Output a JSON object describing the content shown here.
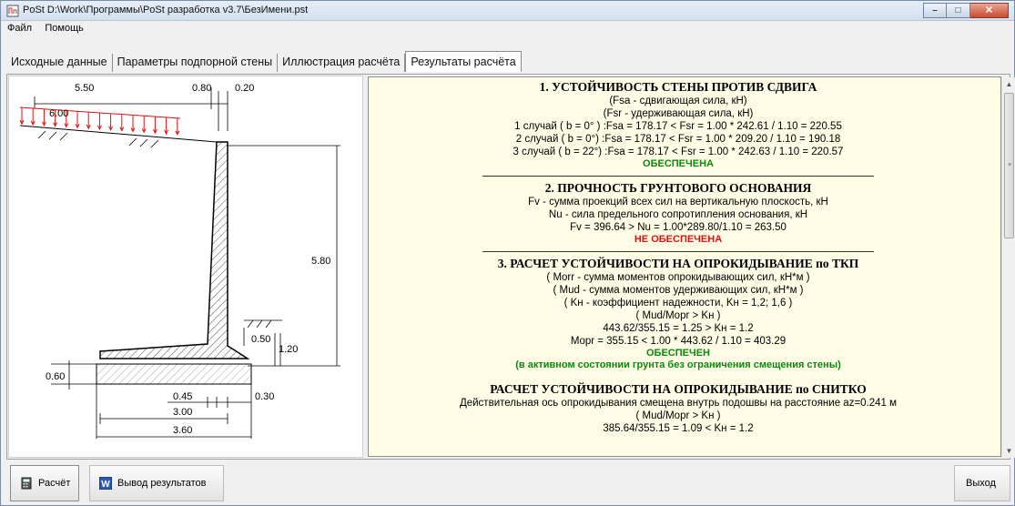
{
  "window": {
    "title": "PoSt  D:\\Work\\Программы\\PoSt разработка v3.7\\БезИмени.pst",
    "minimize_glyph": "–",
    "maximize_glyph": "□",
    "close_glyph": "✕"
  },
  "menu": {
    "items": [
      "Файл",
      "Помощь"
    ]
  },
  "tabs": [
    {
      "label": "Исходные данные",
      "active": false
    },
    {
      "label": "Параметры подпорной стены",
      "active": false
    },
    {
      "label": "Иллюстрация расчёта",
      "active": false
    },
    {
      "label": "Результаты расчёта",
      "active": true
    }
  ],
  "drawing": {
    "dims": {
      "top_left": "5.50",
      "top_mid": "0.80",
      "top_right": "0.20",
      "load": "6.00",
      "height": "5.80",
      "toe_depth": "0.50",
      "toe_height": "1.20",
      "slab": "0.60",
      "bottom_a": "0.45",
      "bottom_b": "0.30",
      "bottom_c": "3.00",
      "bottom_d": "3.60"
    }
  },
  "report": {
    "s1": {
      "title": "1. УСТОЙЧИВОСТЬ СТЕНЫ ПРОТИВ СДВИГА",
      "lines": [
        "(Fsa - сдвигающая сила, кН)",
        "(Fsr - удерживающая сила, кН)",
        "1 случай ( b = 0°  ) :Fsa = 178.17 < Fsr = 1.00 * 242.61 / 1.10 = 220.55",
        "2 случай ( b = 0°) :Fsa = 178.17 < Fsr = 1.00 * 209.20 / 1.10 = 190.18",
        "3 случай ( b = 22°) :Fsa = 178.17 < Fsr = 1.00 * 242.63 / 1.10 = 220.57"
      ],
      "status": "ОБЕСПЕЧЕНА"
    },
    "s2": {
      "title": "2. ПРОЧНОСТЬ ГРУНТОВОГО ОСНОВАНИЯ",
      "lines": [
        "Fv - сумма проекций всех сил на вертикальную плоскость, кН",
        "Nu - сила предельного сопротипления основания, кН",
        "Fv = 396.64  >  Nu = 1.00*289.80/1.10 = 263.50"
      ],
      "status": "НЕ ОБЕСПЕЧЕНА"
    },
    "s3": {
      "title": "3. РАСЧЕТ УСТОЙЧИВОСТИ НА ОПРОКИДЫВАНИЕ по ТКП",
      "lines": [
        "( Morr - сумма моментов опрокидывающих сил, кН*м )",
        "( Mud  - сумма моментов удерживающих сил, кН*м )",
        "( Kн  - коэффициент надежности, Kн = 1,2; 1,6 )",
        "( Mud/Mopr > Kн )",
        "443.62/355.15 = 1.25 > Kн = 1.2",
        "Mopr = 355.15 < 1.00 * 443.62 / 1.10 = 403.29"
      ],
      "status": "ОБЕСПЕЧЕН",
      "note": "(в активном состоянии грунта без ограничения смещения стены)"
    },
    "s4": {
      "title": "РАСЧЕТ УСТОЙЧИВОСТИ НА ОПРОКИДЫВАНИЕ по СНИТКО",
      "lines": [
        "Действительная ось опрокидывания смещена внутрь подошвы на расстояние az=0.241 м",
        "( Mud/Mopr > Kн )",
        "385.64/355.15 = 1.09 < Kн = 1.2"
      ]
    }
  },
  "buttons": {
    "calc": "Расчёт",
    "output": "Вывод результатов",
    "exit": "Выход"
  }
}
